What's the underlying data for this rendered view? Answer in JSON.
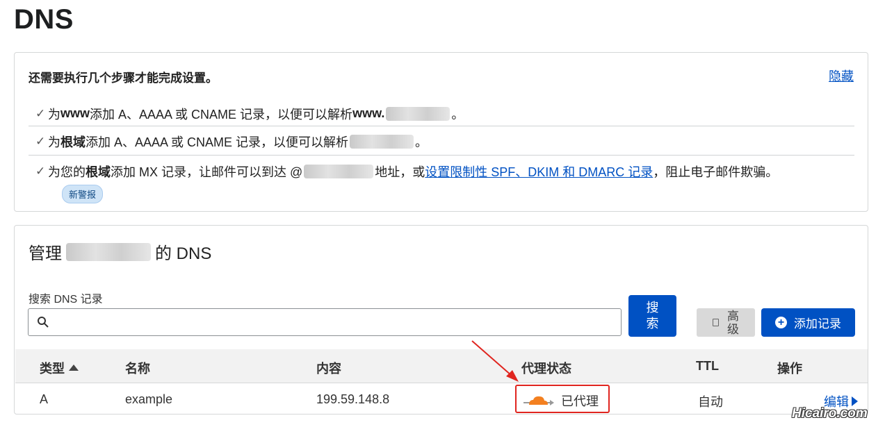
{
  "page": {
    "title": "DNS"
  },
  "setup": {
    "heading": "还需要执行几个步骤才能完成设置。",
    "hide_label": "隐藏",
    "steps": [
      {
        "check_icon": "check-icon",
        "p1": "为 ",
        "b1": "www",
        "p2": " 添加 A、AAAA 或 CNAME 记录，以便可以解析 ",
        "b2": "www.",
        "p3": "。"
      },
      {
        "check_icon": "check-icon",
        "p1": "为",
        "b1": "根域",
        "p2": "添加 A、AAAA 或 CNAME 记录，以便可以解析 ",
        "p3": "。"
      },
      {
        "check_icon": "check-icon",
        "p1": "为您的",
        "b1": "根域",
        "p2": "添加 MX 记录，让邮件可以到达 @",
        "p3": "地址，或",
        "link": "设置限制性 SPF、DKIM 和 DMARC 记录",
        "p4": "，阻止电子邮件欺骗。"
      }
    ],
    "badge": "新警报"
  },
  "manage": {
    "title_prefix": "管理",
    "title_suffix": "的 DNS",
    "search_label": "搜索 DNS 记录",
    "search_placeholder": "",
    "search_button": "搜索",
    "advanced_button": "高级",
    "add_button": "添加记录"
  },
  "table": {
    "headers": {
      "type": "类型",
      "name": "名称",
      "content": "内容",
      "proxy": "代理状态",
      "ttl": "TTL",
      "actions": "操作"
    },
    "rows": [
      {
        "type": "A",
        "name": "example",
        "content": "199.59.148.8",
        "proxy": "已代理",
        "ttl": "自动",
        "action": "编辑"
      }
    ]
  },
  "colors": {
    "accent": "#0051c3",
    "proxy_orange": "#f38020",
    "highlight_red": "#e0251f"
  },
  "watermark": "Hicairo.com"
}
